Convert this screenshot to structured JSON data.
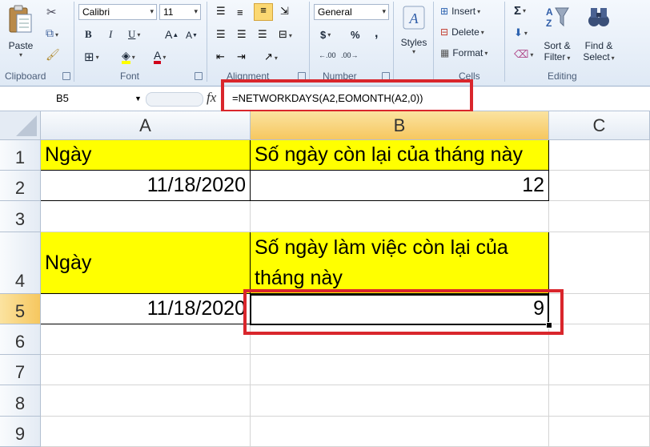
{
  "ribbon": {
    "clipboard": {
      "label": "Clipboard",
      "paste": "Paste"
    },
    "font": {
      "label": "Font",
      "name": "Calibri",
      "size": "11",
      "bold": "B",
      "italic": "I",
      "underline": "U",
      "grow": "A",
      "shrink": "A",
      "color_letter": "A"
    },
    "alignment": {
      "label": "Alignment"
    },
    "number": {
      "label": "Number",
      "format": "General",
      "currency": "$",
      "percent": "%",
      "comma": ",",
      "inc_decimal": ".00",
      "dec_decimal": ".00"
    },
    "styles": {
      "label": "Styles"
    },
    "cells": {
      "label": "Cells",
      "insert": "Insert",
      "delete": "Delete",
      "format": "Format"
    },
    "editing": {
      "label": "Editing",
      "sigma": "Σ",
      "sort_filter_1": "Sort &",
      "sort_filter_2": "Filter",
      "find_select_1": "Find &",
      "find_select_2": "Select"
    }
  },
  "formula_bar": {
    "name_box": "B5",
    "fx": "fx",
    "formula": "=NETWORKDAYS(A2,EOMONTH(A2,0))"
  },
  "grid": {
    "columns": [
      "A",
      "B",
      "C"
    ],
    "rows": [
      "1",
      "2",
      "3",
      "4",
      "5",
      "6",
      "7",
      "8",
      "9"
    ],
    "cells": {
      "A1": "Ngày",
      "B1": "Số ngày còn lại của tháng này",
      "A2": "11/18/2020",
      "B2": "12",
      "A4": "Ngày",
      "B4": "Số ngày làm việc còn lại của tháng này",
      "A5": "11/18/2020",
      "B5": "9"
    },
    "selected_cell": "B5"
  },
  "colors": {
    "highlight_red": "#d9262c",
    "cell_yellow": "#ffff00",
    "selection_header": "#f6c75f"
  }
}
